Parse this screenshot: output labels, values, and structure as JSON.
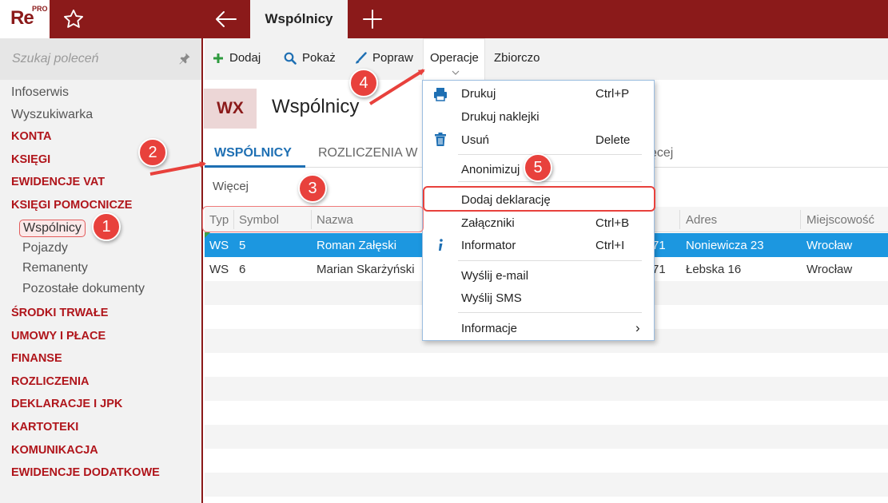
{
  "app": {
    "logo_text": "Re",
    "logo_badge": "PRO",
    "active_tab": "Wspólnicy"
  },
  "sidebar": {
    "search_placeholder": "Szukaj poleceń",
    "items": [
      {
        "label": "Infoserwis",
        "kind": "plain"
      },
      {
        "label": "Wyszukiwarka",
        "kind": "plain"
      },
      {
        "label": "KONTA",
        "kind": "section"
      },
      {
        "label": "KSIĘGI",
        "kind": "section"
      },
      {
        "label": "EWIDENCJE VAT",
        "kind": "section"
      },
      {
        "label": "KSIĘGI POMOCNICZE",
        "kind": "section"
      },
      {
        "label": "Wspólnicy",
        "kind": "selected"
      },
      {
        "label": "Pojazdy",
        "kind": "sub"
      },
      {
        "label": "Remanenty",
        "kind": "sub"
      },
      {
        "label": "Pozostałe dokumenty",
        "kind": "sub"
      },
      {
        "label": "ŚRODKI TRWAŁE",
        "kind": "section"
      },
      {
        "label": "UMOWY I PŁACE",
        "kind": "section"
      },
      {
        "label": "FINANSE",
        "kind": "section"
      },
      {
        "label": "ROZLICZENIA",
        "kind": "section"
      },
      {
        "label": "DEKLARACJE I JPK",
        "kind": "section"
      },
      {
        "label": "KARTOTEKI",
        "kind": "section"
      },
      {
        "label": "KOMUNIKACJA",
        "kind": "section"
      },
      {
        "label": "EWIDENCJE DODATKOWE",
        "kind": "section"
      }
    ]
  },
  "toolbar": {
    "add_label": "Dodaj",
    "show_label": "Pokaż",
    "edit_label": "Popraw",
    "operations_label": "Operacje",
    "summary_label": "Zbiorczo"
  },
  "header": {
    "badge": "WX",
    "title": "Wspólnicy"
  },
  "tabs": {
    "active": "WSPÓLNICY",
    "second": "ROZLICZENIA W",
    "more": "ęcej"
  },
  "more_link": "Więcej",
  "table": {
    "columns": [
      "Typ",
      "Symbol",
      "Nazwa",
      "Adres",
      "Miejscowość"
    ],
    "rows": [
      {
        "typ": "WS",
        "symbol": "5",
        "nazwa": "Roman Załęski",
        "hidden": "71",
        "adres": "Noniewicza 23",
        "miejscowosc": "Wrocław"
      },
      {
        "typ": "WS",
        "symbol": "6",
        "nazwa": "Marian Skarżyński",
        "hidden": "71",
        "adres": "Łebska 16",
        "miejscowosc": "Wrocław"
      }
    ]
  },
  "menu": {
    "items": [
      {
        "label": "Drukuj",
        "shortcut": "Ctrl+P",
        "icon": "printer-icon"
      },
      {
        "label": "Drukuj naklejki",
        "shortcut": ""
      },
      {
        "label": "Usuń",
        "shortcut": "Delete",
        "icon": "trash-icon"
      },
      {
        "label": "Anonimizuj",
        "shortcut": ""
      },
      {
        "label": "Dodaj deklarację",
        "shortcut": ""
      },
      {
        "label": "Załączniki",
        "shortcut": "Ctrl+B"
      },
      {
        "label": "Informator",
        "shortcut": "Ctrl+I",
        "icon": "info-icon"
      },
      {
        "label": "Wyślij e-mail",
        "shortcut": ""
      },
      {
        "label": "Wyślij SMS",
        "shortcut": ""
      },
      {
        "label": "Informacje",
        "shortcut": "›"
      }
    ]
  },
  "annotations": [
    "1",
    "2",
    "3",
    "4",
    "5"
  ],
  "colors": {
    "brand": "#8b1a1a",
    "section": "#b0151b",
    "accent_blue": "#1e6fb3",
    "selection": "#1c97e0",
    "annotation": "#e8413c"
  }
}
